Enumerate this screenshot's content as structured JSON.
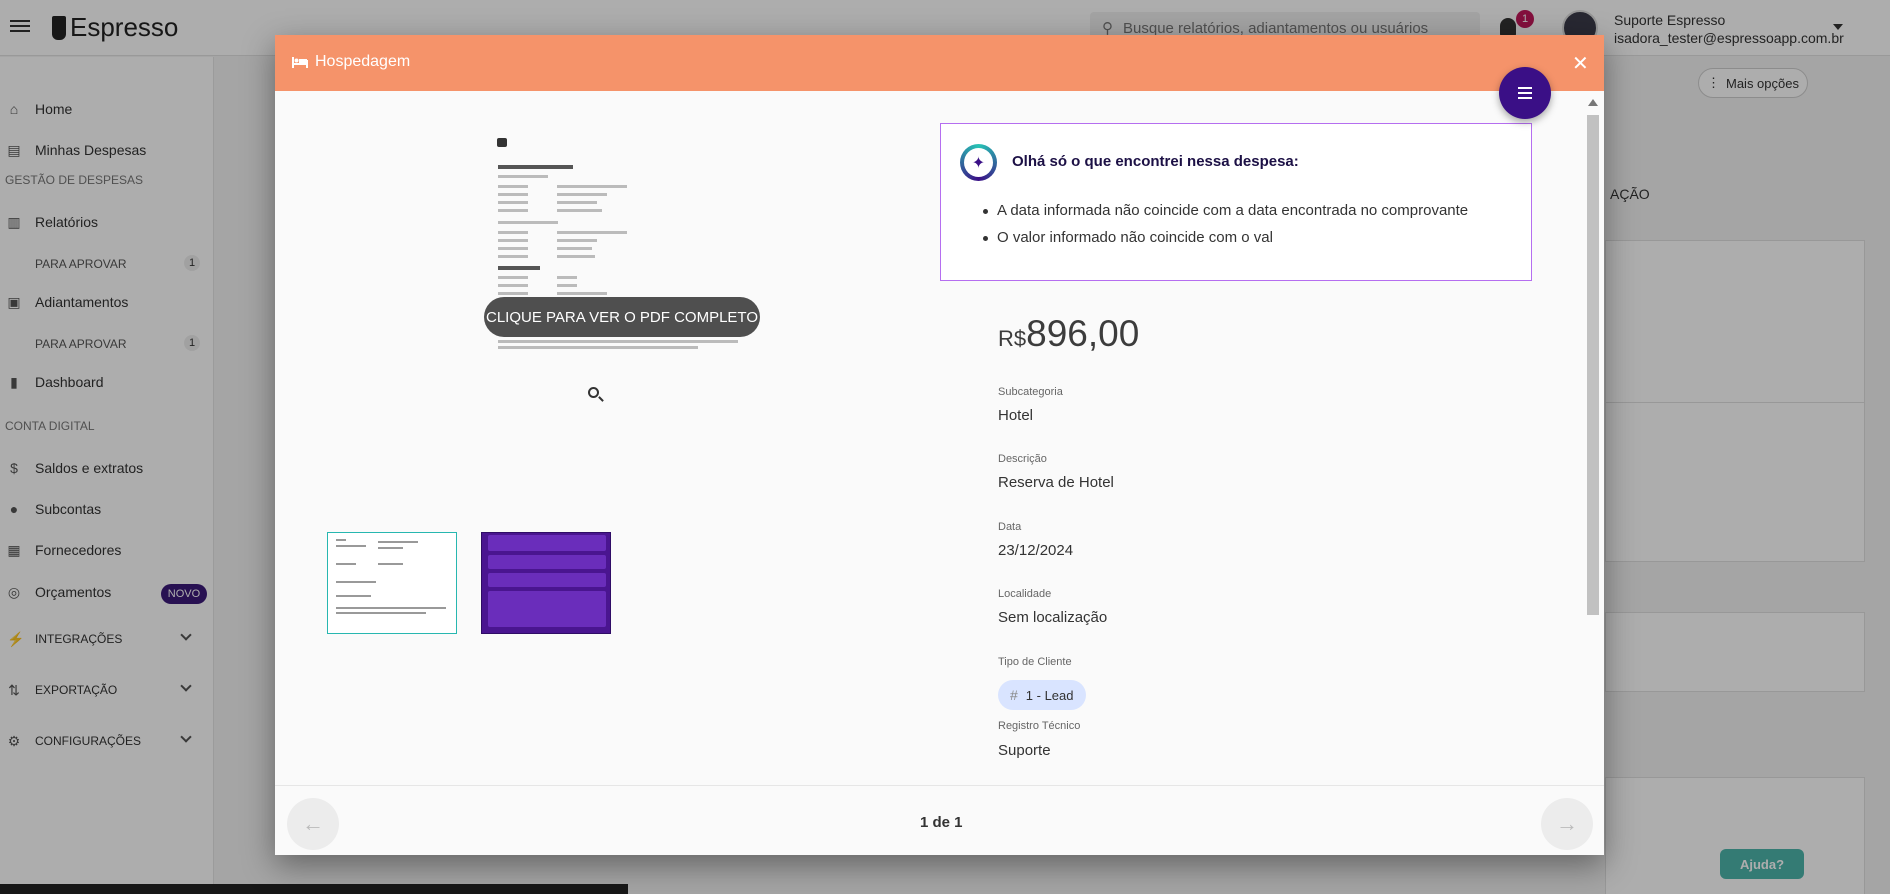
{
  "app": {
    "logo_text": "Espresso",
    "search_placeholder": "Busque relatórios, adiantamentos ou usuários",
    "notification_count": "1",
    "user_name": "Suporte Espresso",
    "user_email": "isadora_tester@espressoapp.com.br"
  },
  "sidebar": {
    "items": [
      {
        "label": "Home",
        "icon": "home-icon"
      },
      {
        "label": "Minhas Despesas",
        "icon": "receipt-icon"
      },
      {
        "label": "GESTÃO DE DESPESAS"
      },
      {
        "label": "Relatórios",
        "icon": "document-icon"
      },
      {
        "label": "PARA APROVAR",
        "count": "1"
      },
      {
        "label": "Adiantamentos",
        "icon": "cash-icon"
      },
      {
        "label": "PARA APROVAR",
        "count": "1"
      },
      {
        "label": "Dashboard",
        "icon": "chart-icon"
      },
      {
        "label": "CONTA DIGITAL"
      },
      {
        "label": "Saldos e extratos",
        "icon": "dollar-icon"
      },
      {
        "label": "Subcontas",
        "icon": "person-icon"
      },
      {
        "label": "Fornecedores",
        "icon": "store-icon"
      },
      {
        "label": "Orçamentos",
        "icon": "budget-icon",
        "badge": "NOVO"
      },
      {
        "label": "INTEGRAÇÕES",
        "icon": "plug-icon"
      },
      {
        "label": "EXPORTAÇÃO",
        "icon": "export-icon"
      },
      {
        "label": "CONFIGURAÇÕES",
        "icon": "gear-icon"
      }
    ]
  },
  "background": {
    "more_options": "Mais opções",
    "column_partial": "AÇÃO",
    "help_button": "Ajuda?"
  },
  "modal": {
    "title": "Hospedagem",
    "view_pdf_label": "CLIQUE PARA VER O PDF COMPLETO",
    "insight_title": "Olhá só o que encontrei nessa despesa:",
    "insights": [
      "A data informada não coincide com a data encontrada no comprovante",
      "O valor informado não coincide com o val"
    ],
    "currency": "R$",
    "amount": "896,00",
    "fields": {
      "subcategoria_label": "Subcategoria",
      "subcategoria_value": "Hotel",
      "descricao_label": "Descrição",
      "descricao_value": "Reserva de Hotel",
      "data_label": "Data",
      "data_value": "23/12/2024",
      "localidade_label": "Localidade",
      "localidade_value": "Sem localização",
      "tipo_cliente_label": "Tipo de Cliente",
      "tipo_cliente_value": "1 - Lead",
      "registro_label": "Registro Técnico",
      "registro_value": "Suporte"
    },
    "pager": "1 de 1"
  },
  "colors": {
    "header": "#f5936a",
    "fab": "#3a0f86",
    "insight_border": "#b56ef0",
    "chip": "#d9e4ff",
    "thumb_selected_border": "#27b7b0"
  }
}
